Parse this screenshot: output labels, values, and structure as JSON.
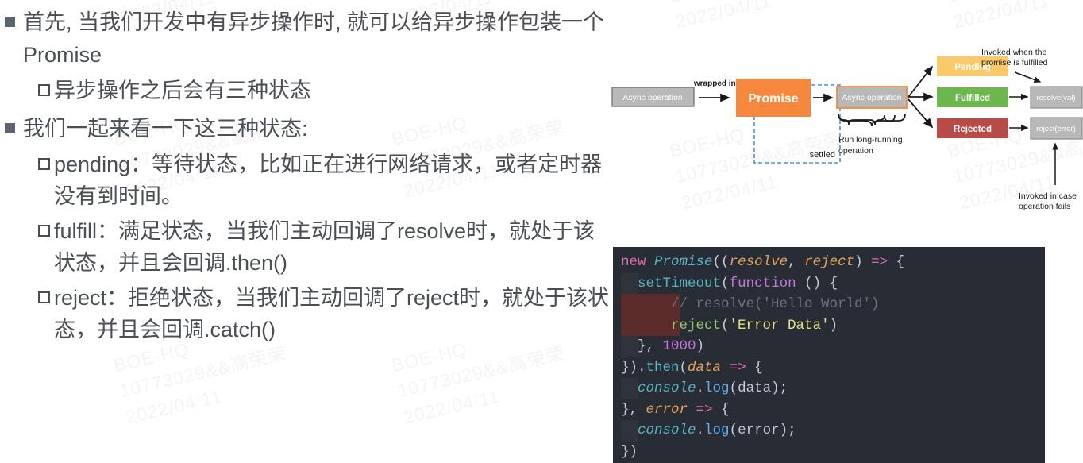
{
  "watermark": {
    "line1": "BOE-HQ",
    "line2": "10773029&&高荣荣",
    "line3": "2022/04/11"
  },
  "content": {
    "bullets": [
      {
        "level": 1,
        "marker": "filled-square",
        "text": "首先, 当我们开发中有异步操作时, 就可以给异步操作包装一个 Promise"
      },
      {
        "level": 2,
        "marker": "hollow-square",
        "text": "异步操作之后会有三种状态"
      },
      {
        "level": 1,
        "marker": "filled-square",
        "text": "我们一起来看一下这三种状态:"
      },
      {
        "level": 2,
        "marker": "hollow-square",
        "text": "pending：等待状态，比如正在进行网络请求，或者定时器没有到时间。"
      },
      {
        "level": 2,
        "marker": "hollow-square",
        "text": "fulfill：满足状态，当我们主动回调了resolve时，就处于该状态，并且会回调.then()"
      },
      {
        "level": 2,
        "marker": "hollow-square",
        "text": "reject：拒绝状态，当我们主动回调了reject时，就处于该状态，并且会回调.catch()"
      }
    ]
  },
  "diagram": {
    "title": "promise-lifecycle-diagram",
    "nodes": [
      {
        "id": "async-op-left",
        "label": "Async operation",
        "fill": "#b8b8b8",
        "text_color": "#ffffff",
        "border": "#7a7a7a"
      },
      {
        "id": "promise",
        "label": "Promise",
        "fill": "#f5883c",
        "text_color": "#ffffff",
        "border": "#f5883c"
      },
      {
        "id": "async-op-mid",
        "label": "Async operation",
        "fill": "#b8b8b8",
        "text_color": "#ffffff",
        "border": "#f5883c"
      },
      {
        "id": "pending",
        "label": "Pending",
        "fill": "#fbc96a",
        "text_color": "#ffffff",
        "border": "#fbc96a"
      },
      {
        "id": "fulfilled",
        "label": "Fulfilled",
        "fill": "#6cb84e",
        "text_color": "#ffffff",
        "border": "#6cb84e"
      },
      {
        "id": "rejected",
        "label": "Rejected",
        "fill": "#b84b46",
        "text_color": "#ffffff",
        "border": "#b84b46"
      },
      {
        "id": "resolve-val",
        "label": "resolve(val)",
        "fill": "#b8b8b8",
        "text_color": "#ffffff",
        "border": "#8c8c8c"
      },
      {
        "id": "reject-error",
        "label": "reject(error)",
        "fill": "#b8b8b8",
        "text_color": "#ffffff",
        "border": "#8c8c8c"
      }
    ],
    "labels": {
      "wrapped_into": "wrapped into",
      "run_long_running": "Run long-running",
      "operation": "operation",
      "settled": "settled",
      "invoked_fulfilled_1": "Invoked when the",
      "invoked_fulfilled_2": "promise is fulfilled",
      "invoked_fails_1": "Invoked in case",
      "invoked_fails_2": "operation fails"
    },
    "settled_box_color": "#4a90d9"
  },
  "code": {
    "background": "#282c34",
    "selection_color": "#5c2b2b",
    "language": "javascript",
    "lines": [
      "new Promise((resolve, reject) => {",
      "  setTimeout(function () {",
      "      // resolve('Hello World')",
      "      reject('Error Data')",
      "  }, 1000)",
      "}).then(data => {",
      "  console.log(data);",
      "}, error => {",
      "  console.log(error);",
      "})"
    ]
  }
}
